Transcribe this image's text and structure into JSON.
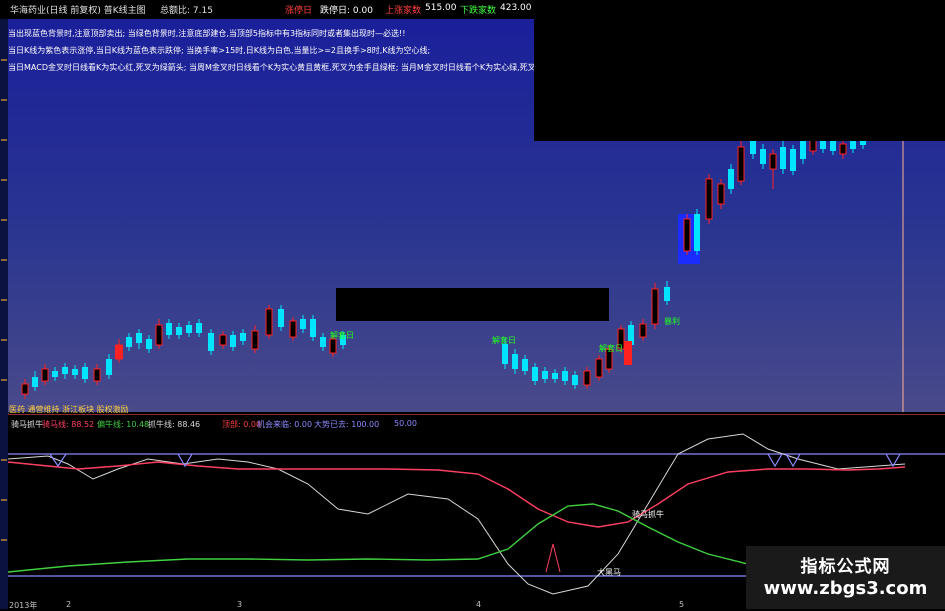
{
  "colors": {
    "up": "#ff2020",
    "down": "#00e5ff",
    "ma_pink": "#ff4060",
    "ma_green": "#40d040",
    "ma_white": "#d8d8d8",
    "band": "#8a8aff",
    "highlight": "#1a2cff",
    "label_green": "#20ff20"
  },
  "header": {
    "title": "华海药业(日线 前复权) 普K线主图",
    "volume_label": "总额比: 7.15",
    "limit_up_label": "涨停日",
    "limit_up_value": "0.00",
    "shanghai_label": "上涨家数",
    "shanghai_value": "515.00",
    "decline_label": "下跌家数",
    "decline_value": "423.00",
    "dieting_label": "跌停日: 0.00"
  },
  "notes": [
    "当出现蓝色背景时,注意顶部卖出; 当绿色背景时,注意底部建仓,当顶部5指标中有3指标同时或者集出现时—必选!!",
    "当日K线为紫色表示涨停,当日K线为蓝色表示跌停; 当换手率>15时,日K线为白色,当量比>=2且换手>8时,K线为空心线;",
    "当日MACD金叉时日线看K为实心红,死叉为绿箭头; 当周M金叉时日线看个K为实心黄且黄框,死叉为金手且绿框; 当月M金叉时日线看个K为实心绿,死叉为金"
  ],
  "labels": {
    "jiehao_1": "解套日",
    "jiehao_2": "解套日",
    "jiehao_3": "解套日",
    "baoli": "暴利",
    "sector_tags": "医药 通营维持 浙江板块 股权激励",
    "jishou_label": "骑马抓牛",
    "damahorse": "大黑马",
    "arrow_down": "↓"
  },
  "indicator": {
    "name": "骑马抓牛",
    "l1": "骑马线: 88.52",
    "l2": "偏牛线: 10.48",
    "l3": "抓牛线: 88.46",
    "l4": "顶部: 0.00",
    "l5": "机会来临: 0.00",
    "l6": "大势已去: 100.00",
    "l7": "50.00"
  },
  "axis": {
    "year": "2013年",
    "t1": "2",
    "t2": "3",
    "t3": "4",
    "t4": "5"
  },
  "watermark": {
    "title": "指标公式网",
    "url": "www.zbgs3.com"
  }
}
